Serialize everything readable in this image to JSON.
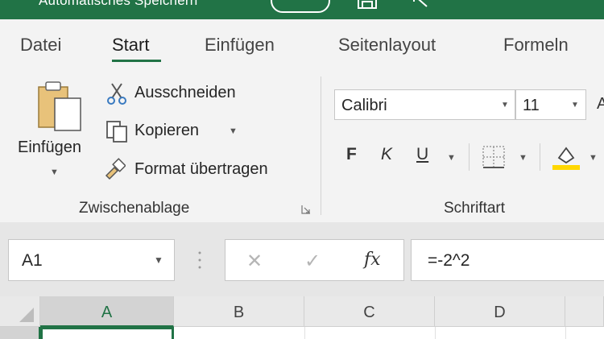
{
  "titlebar": {
    "title": "Automatisches Speichern"
  },
  "tabs": [
    "Datei",
    "Start",
    "Einfügen",
    "Seitenlayout",
    "Formeln"
  ],
  "clipboard": {
    "paste_label": "Einfügen",
    "cut_label": "Ausschneiden",
    "copy_label": "Kopieren",
    "format_painter_label": "Format übertragen",
    "group_label": "Zwischenablage"
  },
  "font": {
    "font_name": "Calibri",
    "font_size": "11",
    "bold": "F",
    "italic": "K",
    "underline": "U",
    "group_label": "Schriftart"
  },
  "formula_bar": {
    "name_box": "A1",
    "formula": "=-2^2"
  },
  "columns": [
    "A",
    "B",
    "C",
    "D"
  ],
  "colors": {
    "accent": "#217346",
    "fill_highlight": "#ffd700"
  }
}
